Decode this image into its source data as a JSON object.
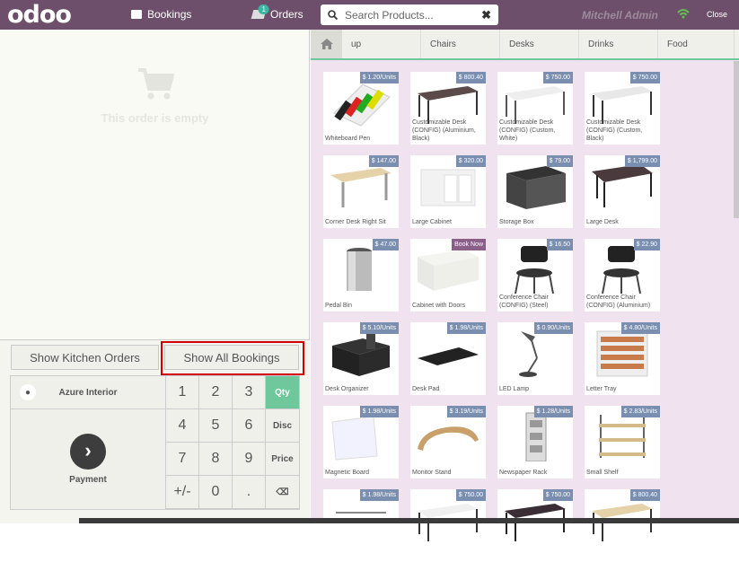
{
  "topbar": {
    "logo": "odoo",
    "bookings_label": "Bookings",
    "orders_label": "Orders",
    "orders_count": "1",
    "search_placeholder": "Search Products...",
    "user_name": "Mitchell Admin",
    "close_label": "Close"
  },
  "cart": {
    "empty_message": "This order is empty"
  },
  "controls": {
    "kitchen_orders": "Show Kitchen Orders",
    "all_bookings": "Show All Bookings",
    "customer": "Azure Interior",
    "payment": "Payment",
    "keys": [
      "1",
      "2",
      "3",
      "Qty",
      "4",
      "5",
      "6",
      "Disc",
      "7",
      "8",
      "9",
      "Price",
      "+/-",
      "0",
      ".",
      "⌫"
    ],
    "selected_mode": "Qty"
  },
  "categories": [
    "up",
    "Chairs",
    "Desks",
    "Drinks",
    "Food"
  ],
  "products": [
    {
      "name": "Whiteboard Pen",
      "price": "$ 1.20/Units"
    },
    {
      "name": "Customizable Desk (CONFIG) (Aluminium, Black)",
      "price": "$ 800.40"
    },
    {
      "name": "Customizable Desk (CONFIG) (Custom, White)",
      "price": "$ 750.00"
    },
    {
      "name": "Customizable Desk (CONFIG) (Custom, Black)",
      "price": "$ 750.00"
    },
    {
      "name": "Corner Desk Right Sit",
      "price": "$ 147.00"
    },
    {
      "name": "Large Cabinet",
      "price": "$ 320.00"
    },
    {
      "name": "Storage Box",
      "price": "$ 79.00"
    },
    {
      "name": "Large Desk",
      "price": "$ 1,799.00"
    },
    {
      "name": "Pedal Bin",
      "price": "$ 47.00"
    },
    {
      "name": "Cabinet with Doors",
      "price": "Book Now"
    },
    {
      "name": "Conference Chair (CONFIG) (Steel)",
      "price": "$ 16.50"
    },
    {
      "name": "Conference Chair (CONFIG) (Aluminium)",
      "price": "$ 22.90"
    },
    {
      "name": "Desk Organizer",
      "price": "$ 5.10/Units"
    },
    {
      "name": "Desk Pad",
      "price": "$ 1.98/Units"
    },
    {
      "name": "LED Lamp",
      "price": "$ 0.90/Units"
    },
    {
      "name": "Letter Tray",
      "price": "$ 4.80/Units"
    },
    {
      "name": "Magnetic Board",
      "price": "$ 1.98/Units"
    },
    {
      "name": "Monitor Stand",
      "price": "$ 3.19/Units"
    },
    {
      "name": "Newspaper Rack",
      "price": "$ 1.28/Units"
    },
    {
      "name": "Small Shelf",
      "price": "$ 2.83/Units"
    },
    {
      "name": "",
      "price": "$ 1.98/Units"
    },
    {
      "name": "",
      "price": "$ 750.00"
    },
    {
      "name": "",
      "price": "$ 750.00"
    },
    {
      "name": "",
      "price": "$ 800.40"
    }
  ],
  "colors": {
    "topbar": "#6e4f6b",
    "accent": "#6ec89b",
    "product_bg": "#f0e2ef",
    "price_tag": "#7a8faf",
    "highlight": "#d40000"
  }
}
